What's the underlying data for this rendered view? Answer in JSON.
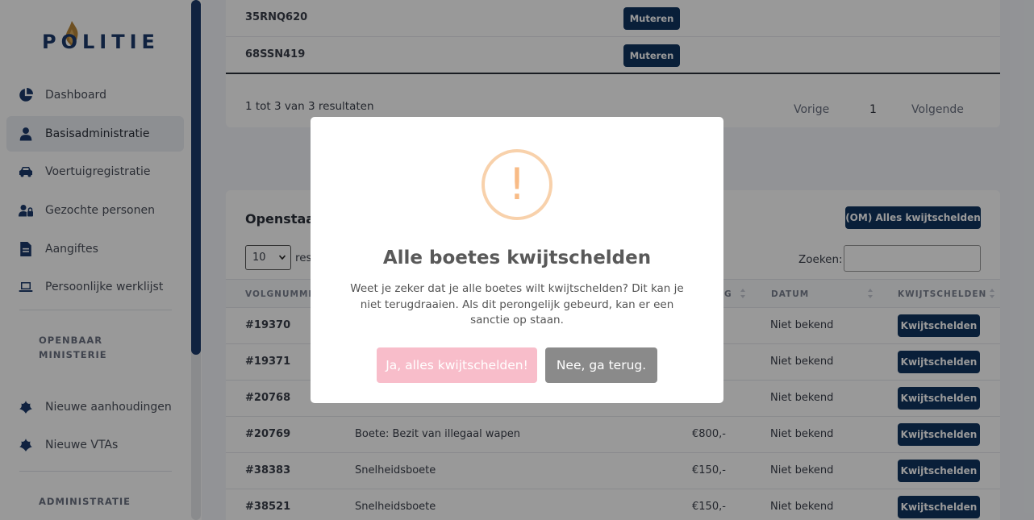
{
  "sidebar": {
    "logo_text": "POLITIE",
    "nav": [
      {
        "label": "Dashboard",
        "icon": "pie-chart-icon"
      },
      {
        "label": "Basisadministratie",
        "icon": "user-icon",
        "active": true
      },
      {
        "label": "Voertuigregistratie",
        "icon": "car-icon"
      },
      {
        "label": "Gezochte personen",
        "icon": "user-lock-icon"
      },
      {
        "label": "Aangiftes",
        "icon": "file-icon"
      },
      {
        "label": "Persoonlijke werklijst",
        "icon": "laptop-icon"
      }
    ],
    "section_om_line1": "OPENBAAR",
    "section_om_line2": "MINISTERIE",
    "nav_om": [
      {
        "label": "Nieuwe aanhoudingen",
        "icon": "police-emblem-icon"
      },
      {
        "label": "Nieuwe VTAs",
        "icon": "police-emblem-icon"
      }
    ],
    "section_admin": "ADMINISTRATIE"
  },
  "vehicles": {
    "rows": [
      {
        "plate": "35RNQ620",
        "action": "Muteren"
      },
      {
        "plate": "68SSN419",
        "action": "Muteren"
      }
    ],
    "results_text": "1 tot 3 van 3 resultaten",
    "pager": {
      "prev": "Vorige",
      "page": "1",
      "next": "Volgende"
    }
  },
  "fines": {
    "title_fragment": "Openstaa",
    "om_button": "(OM) Alles kwijtschelden",
    "page_size": "10",
    "results_fragment": "res",
    "search_label": "Zoeken:",
    "headers": {
      "volgnummer": "VOLGNUMMER",
      "bedrag_fragment": "G",
      "datum": "DATUM",
      "kwijtschelden": "KWIJTSCHELDEN"
    },
    "rows": [
      {
        "id": "#19370",
        "desc": "",
        "amount": "",
        "date": "Niet bekend",
        "action": "Kwijtschelden"
      },
      {
        "id": "#19371",
        "desc": "",
        "amount": "",
        "date": "Niet bekend",
        "action": "Kwijtschelden"
      },
      {
        "id": "#20768",
        "desc": "",
        "amount": "",
        "date": "Niet bekend",
        "action": "Kwijtschelden"
      },
      {
        "id": "#20769",
        "desc": "Boete: Bezit van illegaal wapen",
        "amount": "€800,-",
        "date": "Niet bekend",
        "action": "Kwijtschelden"
      },
      {
        "id": "#38383",
        "desc": "Snelheidsboete",
        "amount": "€150,-",
        "date": "Niet bekend",
        "action": "Kwijtschelden"
      },
      {
        "id": "#38521",
        "desc": "Snelheidsboete",
        "amount": "€150,-",
        "date": "Niet bekend",
        "action": "Kwijtschelden"
      }
    ]
  },
  "modal": {
    "icon": "warning-icon",
    "icon_glyph": "!",
    "title": "Alle boetes kwijtschelden",
    "text": "Weet je zeker dat je alle boetes wilt kwijtschelden? Dit kan je niet terugdraaien. Als dit perongelijk gebeurd, kan er een sanctie op staan.",
    "confirm": "Ja, alles kwijtschelden!",
    "cancel": "Nee, ga terug."
  },
  "colors": {
    "brand": "#1b3a6b",
    "button_dark": "#0f3460",
    "confirm": "#f8bdca",
    "cancel": "#8a8a8a",
    "warning": "#f8bb86"
  }
}
